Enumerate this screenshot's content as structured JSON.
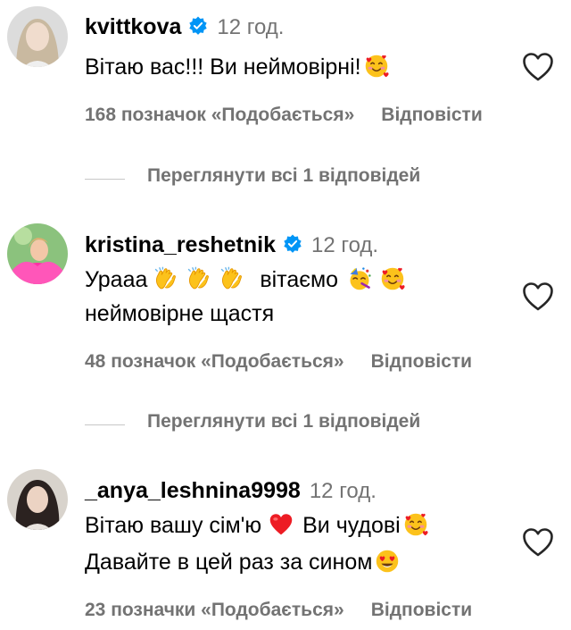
{
  "comments": [
    {
      "username": "kvittkova",
      "time": "12 год.",
      "lines": [
        "Вітаю вас!!! Ви неймовірні!"
      ],
      "likes": "168 позначок «Подобається»",
      "reply": "Відповісти"
    },
    {
      "username": "kristina_reshetnik",
      "time": "12 год.",
      "lines": [
        "Урааа",
        "вітаємо",
        "неймовірне щастя"
      ],
      "likes": "48 позначок «Подобається»",
      "reply": "Відповісти"
    },
    {
      "username": "_anya_leshnina9998",
      "time": "12 год.",
      "lines": [
        "Вітаю вашу сім'ю",
        "Ви чудові",
        "Давайте в цей раз за сином"
      ],
      "likes": "23 позначки «Подобається»",
      "reply": "Відповісти"
    }
  ],
  "view_replies": [
    "Переглянути всі 1 відповідей",
    "Переглянути всі 1 відповідей"
  ],
  "icons": {
    "verified": "verified-badge-icon",
    "like": "heart-outline-icon",
    "emoji_hugging": "smiling-face-with-hearts-emoji",
    "emoji_clap": "clapping-hands-emoji",
    "emoji_party": "partying-face-emoji",
    "emoji_heart": "red-heart-emoji",
    "emoji_heart_eyes": "heart-eyes-emoji"
  },
  "colors": {
    "verified_blue": "#0095f6",
    "secondary_text": "#737373",
    "heart_red": "#ed1c24"
  }
}
